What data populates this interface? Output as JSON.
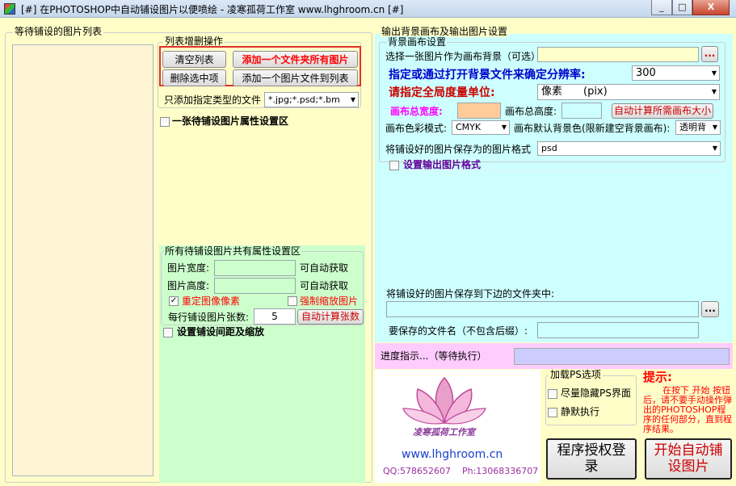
{
  "window": {
    "title": "[#] 在PHOTOSHOP中自动铺设图片以便喷绘 - 凌寒孤荷工作室 www.lhghroom.cn [#]",
    "minimize": "_",
    "maximize": "□",
    "close": "X"
  },
  "left": {
    "list_title": "等待铺设的图片列表",
    "ops_title": "列表增删操作",
    "clear_btn": "清空列表",
    "add_folder_btn": "添加一个文件夹所有图片",
    "delete_btn": "删除选中项",
    "add_file_btn": "添加一个图片文件到列表",
    "filter_label": "只添加指定类型的文件",
    "filter_value": "*.jpg;*.psd;*.bm",
    "single_prop_label": "一张待铺设图片属性设置区",
    "common_title": "所有待铺设图片共有属性设置区",
    "width_label": "图片宽度:",
    "height_label": "图片高度:",
    "auto_get_1": "可自动获取",
    "auto_get_2": "可自动获取",
    "resample_label": "重定图像像素",
    "resample_checked": true,
    "force_scale_label": "强制缩放图片",
    "per_row_label": "每行铺设图片张数:",
    "per_row_value": "5",
    "auto_count_btn": "自动计算张数",
    "spacing_label": "设置铺设间距及缩放"
  },
  "right": {
    "section_title": "输出背景画布及输出图片设置",
    "bg_title": "背景画布设置",
    "choose_bg_label": "选择一张图片作为画布背景（可选）",
    "browse": "...",
    "resolution_label": "指定或通过打开背景文件来确定分辨率:",
    "resolution_value": "300",
    "unit_label": "请指定全局度量单位:",
    "unit_value": "像素　　(pix)",
    "total_width_label": "画布总宽度:",
    "total_height_label": "画布总高度:",
    "auto_calc_canvas_btn": "自动计算所需画布大小",
    "color_mode_label": "画布色彩模式:",
    "color_mode_value": "CMYK",
    "default_bg_label": "画布默认背景色(限新建空背景画布):",
    "default_bg_value": "透明背",
    "save_format_label": "将铺设好的图片保存为的图片格式",
    "save_format_value": "psd",
    "output_format_label": "设置输出图片格式",
    "save_folder_label": "将铺设好的图片保存到下边的文件夹中:",
    "browse2": "...",
    "filename_label": "要保存的文件名（不包含后缀）:"
  },
  "progress": {
    "label": "进度指示...（等待执行）"
  },
  "bottom": {
    "studio_name": "凌寒孤荷工作室",
    "website": "www.lhghroom.cn",
    "qq": "QQ:578652607",
    "phone": "Ph:13068336707",
    "ps_options_title": "加载PS选项",
    "hide_ps_label": "尽量隐藏PS界面",
    "silent_label": "静默执行",
    "tip_title": "提示:",
    "tip_text": "在按下 开始 按钮后，请不要手动操作弹出的PHOTOSHOP程序的任何部分，直到程序结果。",
    "license_btn": "程序授权登录",
    "start_btn": "开始自动铺设图片"
  },
  "colors": {
    "panel": "#fffec8",
    "right_panel": "#ccfffe",
    "common_panel": "#ccffcc",
    "progress_bg": "#ffccff",
    "progress_bar": "#ccccff",
    "red": "#ff0000",
    "blue": "#0000cc"
  }
}
